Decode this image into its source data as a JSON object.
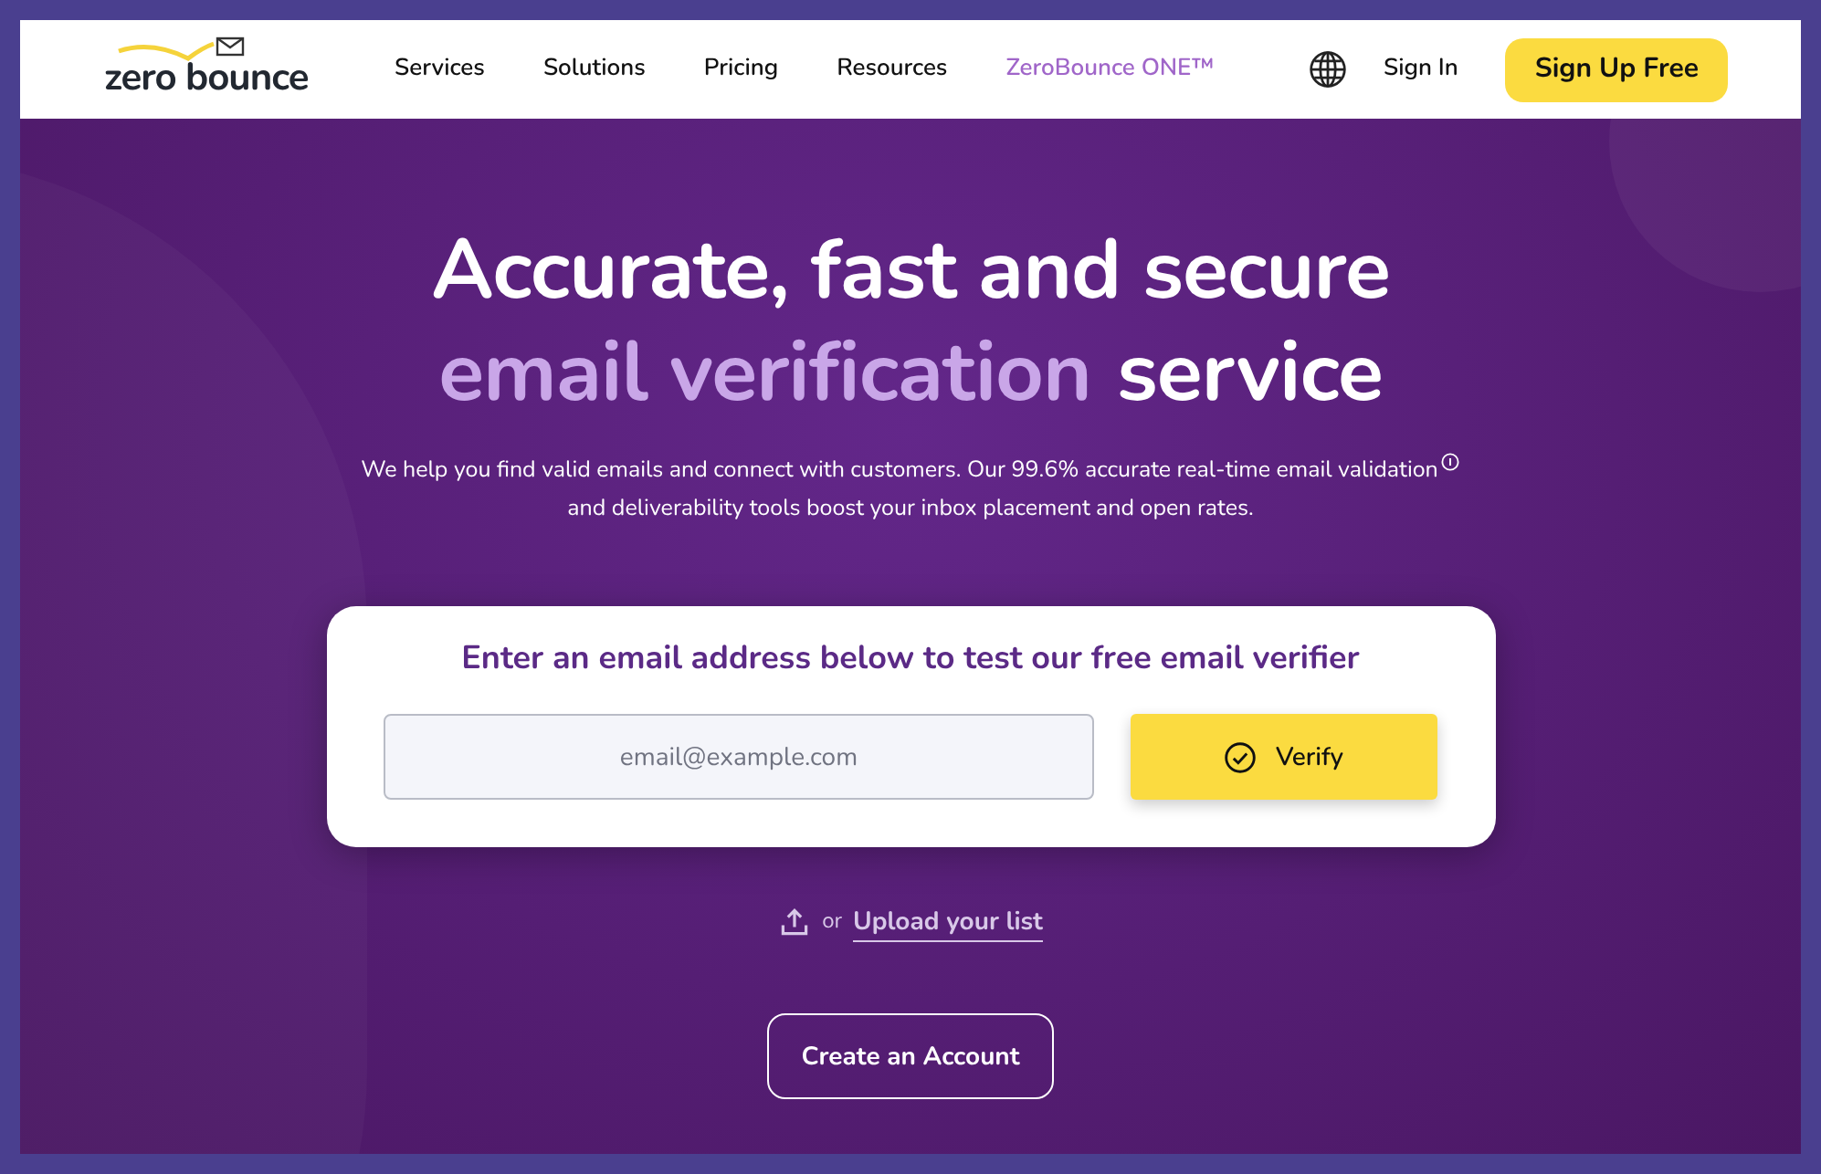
{
  "nav": {
    "logo": "zero bounce",
    "links": [
      {
        "label": "Services",
        "accent": false
      },
      {
        "label": "Solutions",
        "accent": false
      },
      {
        "label": "Pricing",
        "accent": false
      },
      {
        "label": "Resources",
        "accent": false
      },
      {
        "label": "ZeroBounce ONE™",
        "accent": true
      }
    ],
    "sign_in": "Sign In",
    "sign_up": "Sign Up Free"
  },
  "hero": {
    "title_line1": "Accurate, fast and secure",
    "title_accent": "email verification",
    "title_rest": "service",
    "description_line1": "We help you find valid emails and connect with customers. Our 99.6% accurate real-time email validation",
    "description_line2": "and deliverability tools boost your inbox placement and open rates."
  },
  "verifier": {
    "heading": "Enter an email address below to test our free email verifier",
    "placeholder": "email@example.com",
    "button": "Verify"
  },
  "upload": {
    "prefix": "or",
    "link": "Upload your list"
  },
  "create_account": "Create an Account"
}
